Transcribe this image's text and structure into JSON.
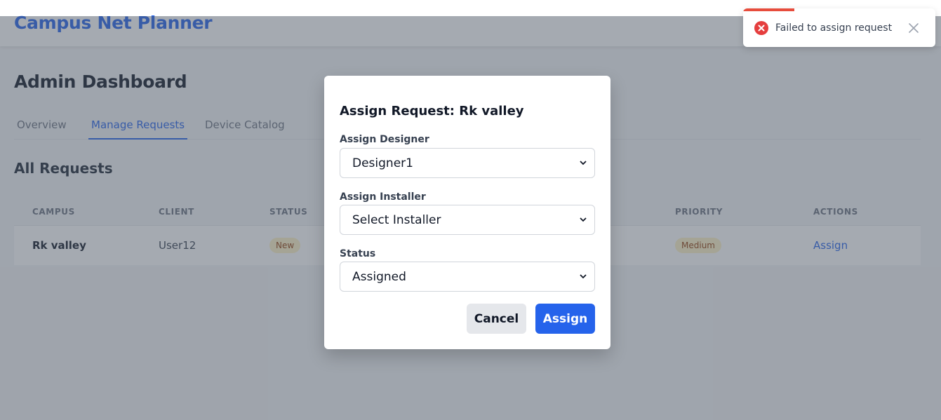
{
  "app": {
    "brand": "Campus Net Planner"
  },
  "page": {
    "title": "Admin Dashboard"
  },
  "tabs": [
    {
      "label": "Overview",
      "active": false
    },
    {
      "label": "Manage Requests",
      "active": true
    },
    {
      "label": "Device Catalog",
      "active": false
    }
  ],
  "section": {
    "title": "All Requests"
  },
  "table": {
    "headers": [
      "CAMPUS",
      "CLIENT",
      "STATUS",
      "PRIORITY",
      "ACTIONS"
    ],
    "rows": [
      {
        "campus": "Rk valley",
        "client": "User12",
        "status": "New",
        "priority": "Medium",
        "action": "Assign"
      }
    ]
  },
  "modal": {
    "title": "Assign Request: Rk valley",
    "designer": {
      "label": "Assign Designer",
      "value": "Designer1"
    },
    "installer": {
      "label": "Assign Installer",
      "value": "Select Installer"
    },
    "status": {
      "label": "Status",
      "value": "Assigned"
    },
    "cancel_label": "Cancel",
    "assign_label": "Assign"
  },
  "toast": {
    "message": "Failed to assign request",
    "type": "error",
    "color": "#e53e3e"
  },
  "colors": {
    "primary": "#2563eb",
    "badge_bg": "#fef3c7",
    "badge_text": "#92400e"
  }
}
